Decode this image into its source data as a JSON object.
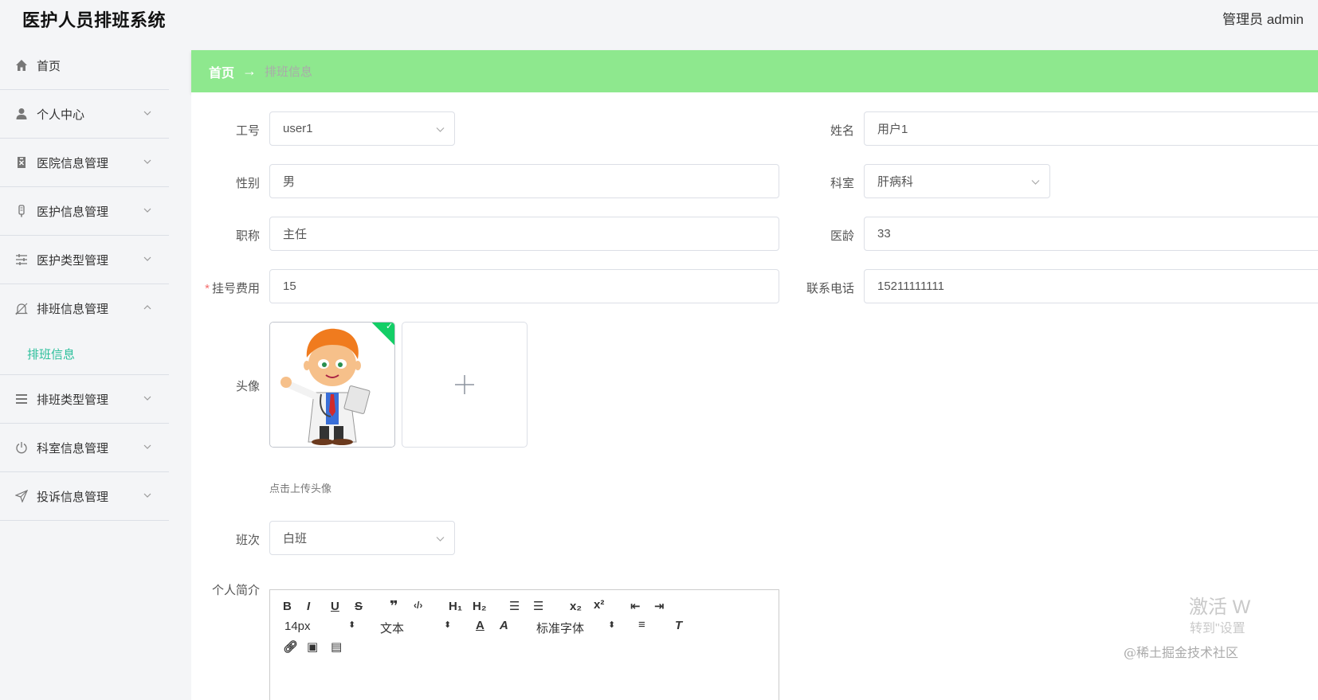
{
  "app": {
    "title": "医护人员排班系统",
    "user_role": "管理员",
    "user_name": "admin"
  },
  "sidebar": {
    "items": [
      {
        "label": "首页",
        "icon": "home-icon",
        "expanded": false
      },
      {
        "label": "个人中心",
        "icon": "user-icon",
        "expanded": false
      },
      {
        "label": "医院信息管理",
        "icon": "hospital-icon",
        "expanded": false
      },
      {
        "label": "医护信息管理",
        "icon": "thermometer-icon",
        "expanded": false
      },
      {
        "label": "医护类型管理",
        "icon": "sliders-icon",
        "expanded": false
      },
      {
        "label": "排班信息管理",
        "icon": "bell-icon",
        "expanded": true,
        "children": [
          "排班信息"
        ]
      },
      {
        "label": "排班类型管理",
        "icon": "menu-icon",
        "expanded": false
      },
      {
        "label": "科室信息管理",
        "icon": "power-icon",
        "expanded": false
      },
      {
        "label": "投诉信息管理",
        "icon": "send-icon",
        "expanded": false
      }
    ]
  },
  "breadcrumb": {
    "home": "首页",
    "separator": "→",
    "current": "排班信息"
  },
  "form": {
    "gonghao": {
      "label": "工号",
      "value": "user1"
    },
    "xingming": {
      "label": "姓名",
      "value": "用户1"
    },
    "xingbie": {
      "label": "性别",
      "value": "男"
    },
    "keshi": {
      "label": "科室",
      "value": "肝病科"
    },
    "zhicheng": {
      "label": "职称",
      "value": "主任"
    },
    "yiling": {
      "label": "医龄",
      "value": "33"
    },
    "guahao": {
      "label": "挂号费用",
      "required_mark": "*",
      "value": "15"
    },
    "dianhua": {
      "label": "联系电话",
      "value": "15211111111"
    },
    "touxiang": {
      "label": "头像",
      "hint": "点击上传头像",
      "upload_symbol": "+"
    },
    "banci": {
      "label": "班次",
      "value": "白班"
    },
    "jianjie": {
      "label": "个人简介"
    }
  },
  "editor": {
    "font_size": "14px",
    "text_style": "文本",
    "font_family": "标准字体",
    "tools": [
      "B",
      "I",
      "U",
      "S",
      "quote",
      "code",
      "H1",
      "H2",
      "ordered-list",
      "bullet-list",
      "subscript",
      "superscript",
      "outdent",
      "indent",
      "font-color",
      "background-color",
      "align",
      "clear-format",
      "link",
      "image",
      "video"
    ]
  },
  "watermarks": {
    "windows_line1": "激活 W",
    "windows_line2": "转到\"设置",
    "site": "@稀土掘金技术社区"
  },
  "colors": {
    "accent": "#2bbf9b",
    "breadcrumb_bg": "#8ee88e",
    "success": "#13ce66",
    "required": "#f56c6c"
  }
}
